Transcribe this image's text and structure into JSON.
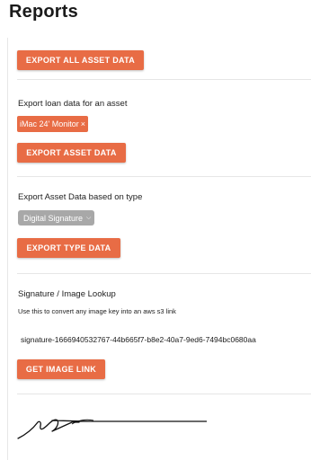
{
  "page": {
    "title": "Reports"
  },
  "export_all": {
    "button_label": "EXPORT ALL ASSET DATA"
  },
  "export_asset": {
    "heading": "Export loan data for an asset",
    "selected_chip": "iMac 24' Monitor",
    "chip_remove_glyph": "×",
    "button_label": "EXPORT ASSET DATA"
  },
  "export_type": {
    "heading": "Export Asset Data based on type",
    "selected_type": "Digital Signature",
    "select_icon": "chevron-down-icon",
    "button_label": "EXPORT TYPE DATA"
  },
  "lookup": {
    "heading": "Signature / Image Lookup",
    "help_text": "Use this to convert any image key into an aws s3 link",
    "image_key": "signature-1666940532767-44b665f7-b8e2-40a7-9ed6-7494bc0680aa",
    "button_label": "GET IMAGE LINK"
  },
  "colors": {
    "accent": "#e86c45",
    "select_bg": "#a8a8a8",
    "divider": "#e6e6e6"
  }
}
